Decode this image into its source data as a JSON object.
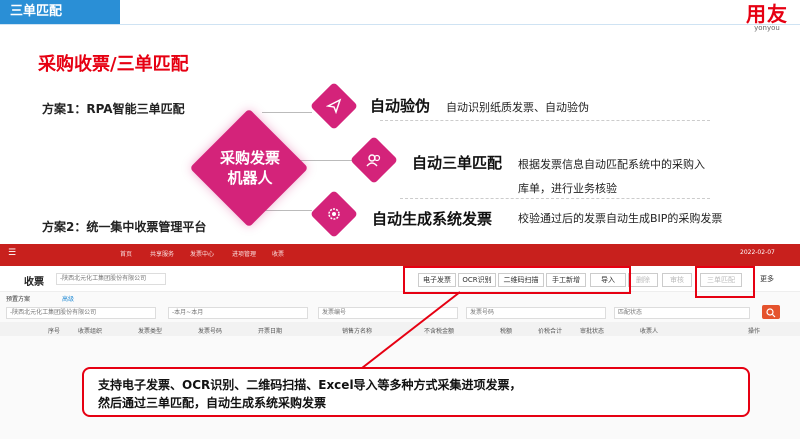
{
  "header": {
    "tab": "三单匹配",
    "logo": "用友",
    "logo_sub": "yonyou"
  },
  "title": "采购收票/三单匹配",
  "plans": {
    "plan1": "方案1：RPA智能三单匹配",
    "plan2": "方案2：统一集中收票管理平台"
  },
  "robot": {
    "line1": "采购发票",
    "line2": "机器人"
  },
  "features": [
    {
      "title": "自动验伪",
      "desc": "自动识别纸质发票、自动验伪",
      "icon": "send-icon"
    },
    {
      "title": "自动三单匹配",
      "desc": "根据发票信息自动匹配系统中的采购入",
      "desc2": "库单，进行业务核验",
      "icon": "users-icon"
    },
    {
      "title": "自动生成系统发票",
      "desc": "校验通过后的发票自动生成BIP的采购发票",
      "icon": "gear-icon"
    }
  ],
  "app": {
    "breadcrumbs": [
      "首页",
      "共享服务",
      "发票中心",
      "进项管理",
      "收票"
    ],
    "date": "2022-02-07",
    "page_title": "收票",
    "org_select": "-陕西北元化工集团股份有限公司",
    "buttons": [
      "电子发票",
      "OCR识别",
      "二维码扫描",
      "手工新增",
      "导入"
    ],
    "gray_buttons": [
      "删除",
      "审核",
      "三单匹配",
      "更多"
    ],
    "scheme": "预置方案",
    "advanced": "高级",
    "filter_org": "-陕西北元化工集团股份有限公司",
    "filter_month": "-本月~本月",
    "filter_vendor": "发票编号",
    "filter_no": "发票号码",
    "filter_status": "匹配状态",
    "columns": [
      "序号",
      "收票组织",
      "发票类型",
      "发票号码",
      "开票日期",
      "销售方名称",
      "不含税金额",
      "税额",
      "价税合计",
      "审批状态",
      "收票人",
      "操作"
    ]
  },
  "callout": {
    "line1": "支持电子发票、OCR识别、二维码扫描、Excel导入等多种方式采集进项发票，",
    "line2": "然后通过三单匹配，自动生成系统采购发票"
  },
  "colors": {
    "accent": "#d4237a",
    "red": "#e60012",
    "blue": "#2a8fd6",
    "appbar": "#c8201d"
  }
}
